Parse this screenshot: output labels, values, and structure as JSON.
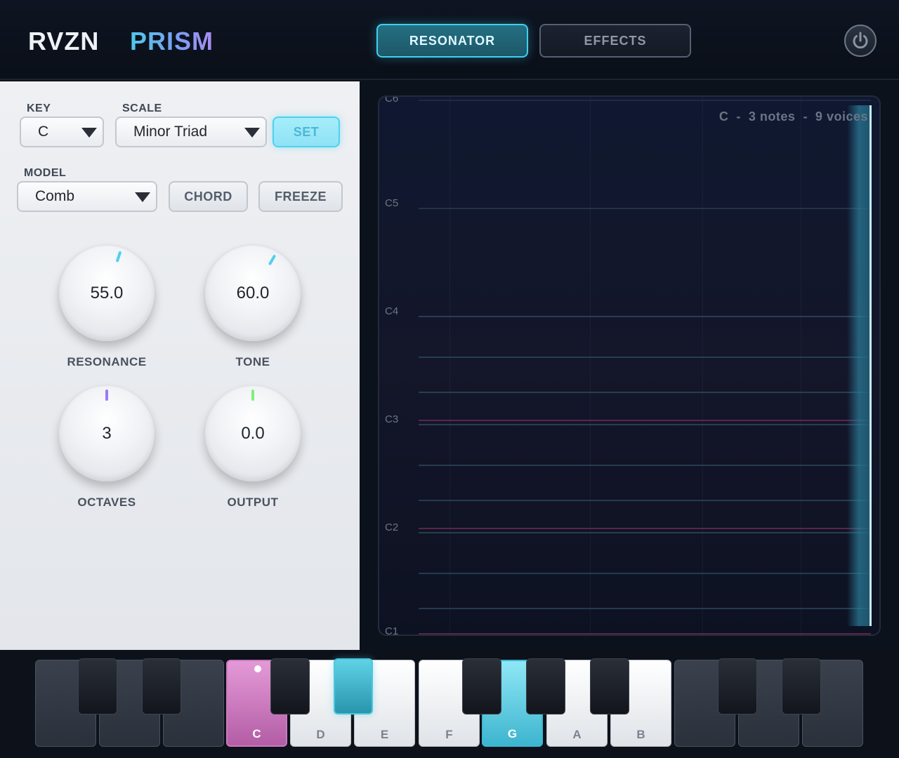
{
  "header": {
    "brand": "RVZN",
    "product": "PRISM",
    "tabs": [
      {
        "label": "RESONATOR",
        "active": true
      },
      {
        "label": "EFFECTS",
        "active": false
      }
    ],
    "power_icon": "power-icon"
  },
  "controls": {
    "key_label": "KEY",
    "key_value": "C",
    "scale_label": "SCALE",
    "scale_value": "Minor Triad",
    "set_label": "SET",
    "model_label": "MODEL",
    "model_value": "Comb",
    "chord_label": "CHORD",
    "freeze_label": "FREEZE"
  },
  "knobs": [
    {
      "label": "RESONANCE",
      "value": "55.0",
      "color": "#4fd1ee"
    },
    {
      "label": "TONE",
      "value": "60.0",
      "color": "#4fd1ee"
    },
    {
      "label": "OCTAVES",
      "value": "3",
      "color": "#9a7bf0"
    },
    {
      "label": "OUTPUT",
      "value": "0.0",
      "color": "#7ff07a"
    }
  ],
  "visualizer": {
    "octave_labels": [
      "C6",
      "C5",
      "C4",
      "C3",
      "C2",
      "C1"
    ],
    "info": "C  -  3 notes  -  9 voices"
  },
  "keyboard": {
    "white_keys": [
      "",
      "",
      "",
      "C",
      "D",
      "E",
      "F",
      "G",
      "A",
      "B",
      "",
      "",
      ""
    ],
    "root_note": "C",
    "highlight_color": "#3db5cf",
    "root_color": "#c87abd"
  }
}
